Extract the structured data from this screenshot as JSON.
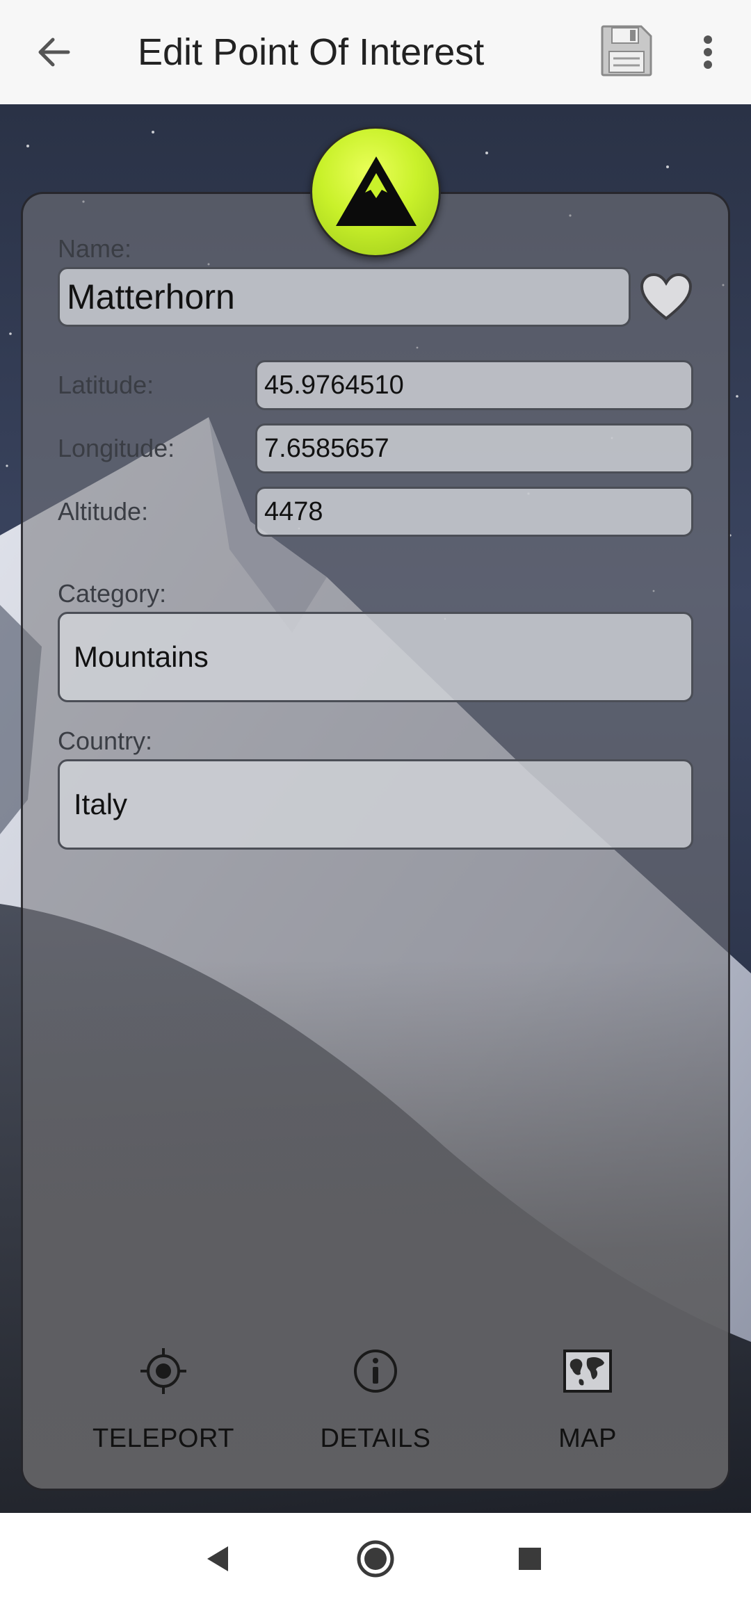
{
  "appbar": {
    "title": "Edit Point Of Interest",
    "icons": {
      "back": "back-arrow-icon",
      "save": "floppy-disk-icon",
      "more": "more-vert-icon"
    }
  },
  "poi": {
    "icon": "mountain-icon",
    "name_label": "Name:",
    "name_value": "Matterhorn",
    "favorite_icon": "heart-icon",
    "latitude_label": "Latitude:",
    "latitude_value": "45.9764510",
    "longitude_label": "Longitude:",
    "longitude_value": "7.6585657",
    "altitude_label": "Altitude:",
    "altitude_value": "4478",
    "category_label": "Category:",
    "category_value": "Mountains",
    "country_label": "Country:",
    "country_value": "Italy"
  },
  "actions": [
    {
      "label": "TELEPORT",
      "icon": "crosshair-icon"
    },
    {
      "label": "DETAILS",
      "icon": "info-icon"
    },
    {
      "label": "MAP",
      "icon": "world-map-icon"
    }
  ],
  "system_nav": {
    "back": "nav-back-icon",
    "home": "nav-home-icon",
    "recents": "nav-recents-icon"
  },
  "colors": {
    "accent": "#c9f12a",
    "appbar": "#f7f7f7",
    "sky": "#1a2233"
  }
}
